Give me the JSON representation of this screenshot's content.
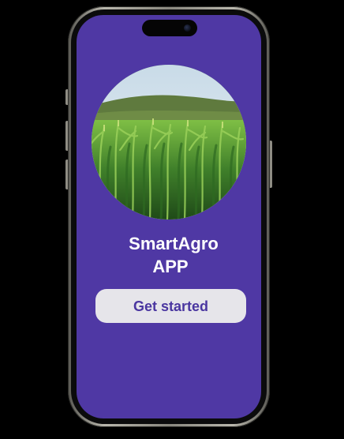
{
  "screen": {
    "background_color": "#4f38a4"
  },
  "hero": {
    "image_name": "corn-field-photo"
  },
  "title": {
    "line1": "SmartAgro",
    "line2": "APP"
  },
  "cta": {
    "label": "Get started",
    "background_color": "#e6e5ea",
    "text_color": "#4a36a0"
  }
}
